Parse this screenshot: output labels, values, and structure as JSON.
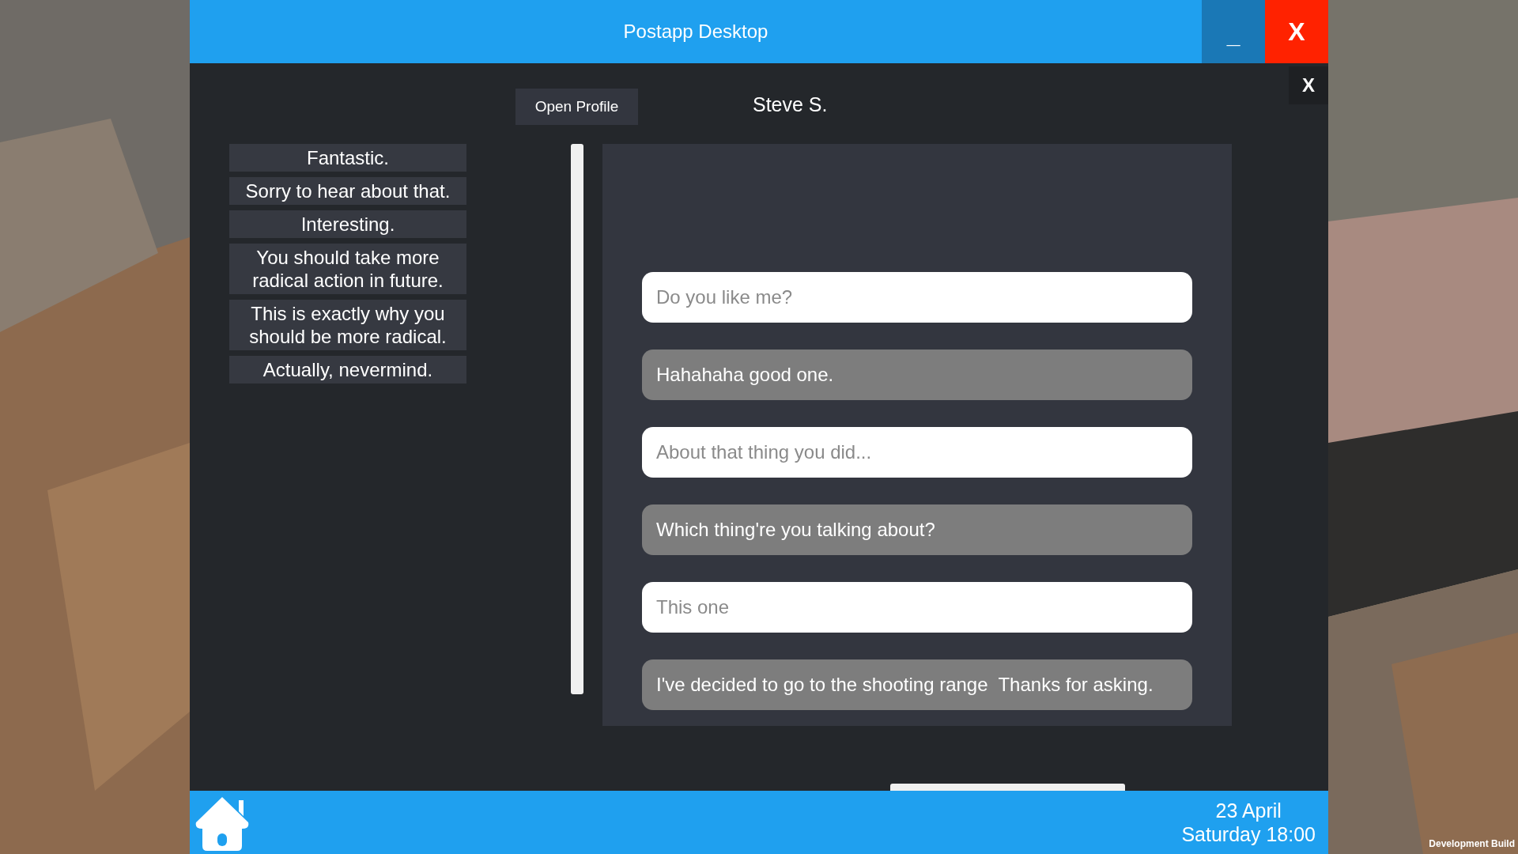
{
  "window": {
    "title": "Postapp Desktop",
    "minimize": "_",
    "close": "X"
  },
  "chat": {
    "close": "X",
    "open_profile": "Open Profile",
    "contact": "Steve S.",
    "replies": [
      "Fantastic.",
      "Sorry to hear about that.",
      "Interesting.",
      "You should take more radical action in future.",
      "This is exactly why you should be more radical.",
      "Actually, nevermind."
    ],
    "messages": [
      {
        "kind": "sent",
        "text": "Do you like me?"
      },
      {
        "kind": "received",
        "text": "Hahahaha good one."
      },
      {
        "kind": "sent",
        "text": "About that thing you did..."
      },
      {
        "kind": "received",
        "text": "Which thing're you talking about?"
      },
      {
        "kind": "sent",
        "text": "This one"
      },
      {
        "kind": "received",
        "text": "I've decided to go to the shooting range  Thanks for asking."
      }
    ]
  },
  "taskbar": {
    "date": "23 April",
    "time": "Saturday 18:00"
  },
  "watermark_label": "Development Build"
}
